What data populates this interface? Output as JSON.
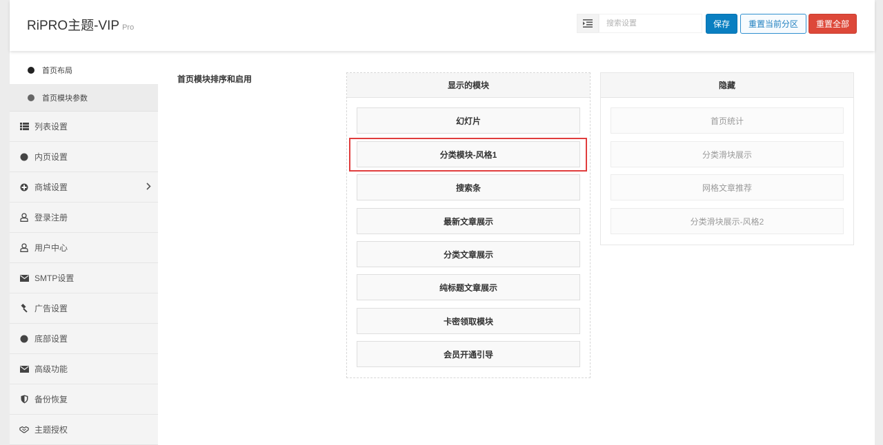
{
  "app": {
    "brand": "RiPRO主题-VIP",
    "version": "Pro"
  },
  "header": {
    "list_icon": "list-icon",
    "search_placeholder": "搜索设置",
    "save_label": "保存",
    "reset_section_label": "重置当前分区",
    "reset_all_label": "重置全部"
  },
  "sidebar": {
    "subitems": [
      {
        "label": "首页布局",
        "active": true
      },
      {
        "label": "首页模块参数",
        "active": false
      }
    ],
    "items": [
      {
        "label": "列表设置",
        "icon": "list-icon"
      },
      {
        "label": "内页设置",
        "icon": "circle-icon"
      },
      {
        "label": "商城设置",
        "icon": "plus-circle-icon",
        "has_children": true
      },
      {
        "label": "登录注册",
        "icon": "user-icon"
      },
      {
        "label": "用户中心",
        "icon": "user-icon"
      },
      {
        "label": "SMTP设置",
        "icon": "envelope-icon"
      },
      {
        "label": "广告设置",
        "icon": "gavel-icon"
      },
      {
        "label": "底部设置",
        "icon": "circle-icon"
      },
      {
        "label": "高级功能",
        "icon": "envelope-icon"
      },
      {
        "label": "备份恢复",
        "icon": "shield-icon"
      },
      {
        "label": "主题授权",
        "icon": "handshake-icon"
      }
    ]
  },
  "content": {
    "section_title": "首页模块排序和启用",
    "visible_panel": {
      "title": "显示的模块",
      "modules": [
        "幻灯片",
        "分类模块-风格1",
        "搜索条",
        "最新文章展示",
        "分类文章展示",
        "纯标题文章展示",
        "卡密领取模块",
        "会员开通引导"
      ]
    },
    "hidden_panel": {
      "title": "隐藏",
      "modules": [
        "首页统计",
        "分类滑块展示",
        "网格文章推荐",
        "分类滑块展示-风格2"
      ]
    },
    "highlight_color": "#e03c3c"
  }
}
